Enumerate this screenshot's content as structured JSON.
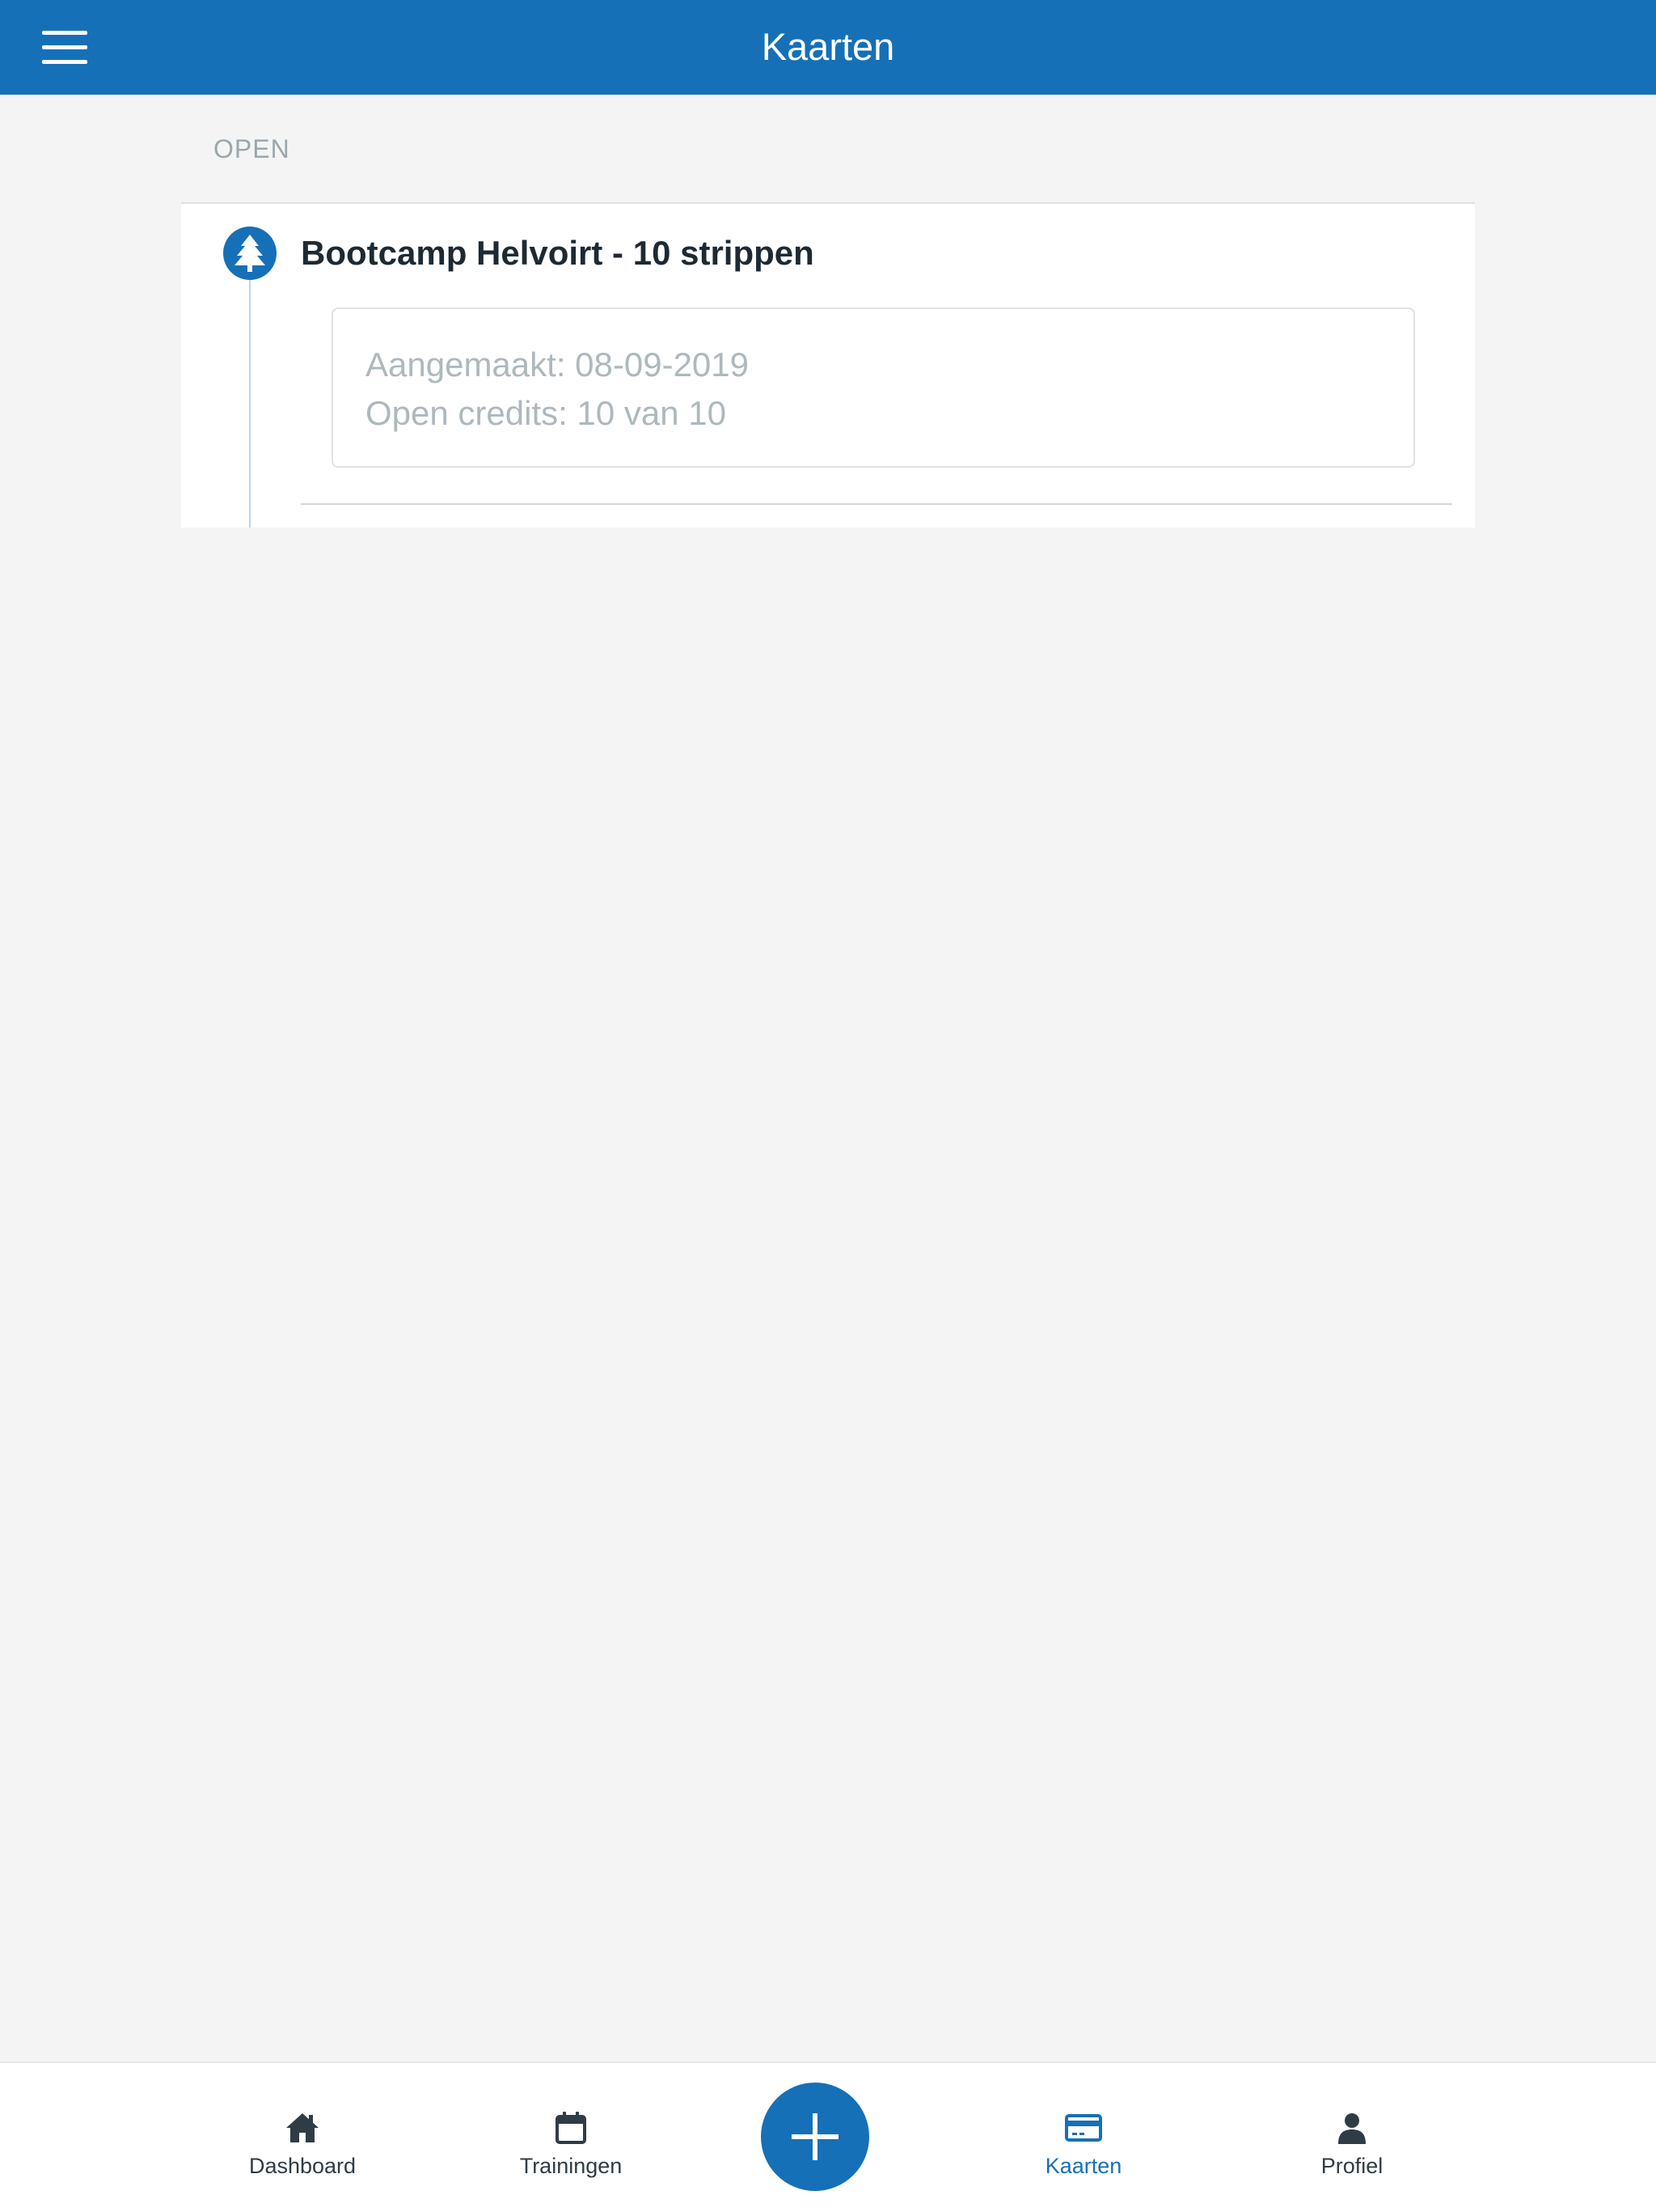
{
  "header": {
    "title": "Kaarten",
    "menu_icon": "hamburger-menu-icon"
  },
  "section": {
    "label": "OPEN"
  },
  "cards": [
    {
      "icon": "tree-icon",
      "title": "Bootcamp Helvoirt - 10 strippen",
      "created": "Aangemaakt: 08-09-2019",
      "credits": "Open credits: 10 van 10"
    }
  ],
  "tabbar": {
    "tabs": [
      {
        "label": "Dashboard",
        "icon": "home-icon",
        "active": false
      },
      {
        "label": "Trainingen",
        "icon": "calendar-icon",
        "active": false
      },
      {
        "label": "Kaarten",
        "icon": "credit-card-icon",
        "active": true
      },
      {
        "label": "Profiel",
        "icon": "user-icon",
        "active": false
      }
    ],
    "add_icon": "plus-icon"
  },
  "colors": {
    "primary": "#1670b7",
    "background": "#f4f4f4",
    "text_dark": "#1e2a33",
    "text_muted": "#aeb8bd",
    "tab_text": "#2f3c45"
  }
}
